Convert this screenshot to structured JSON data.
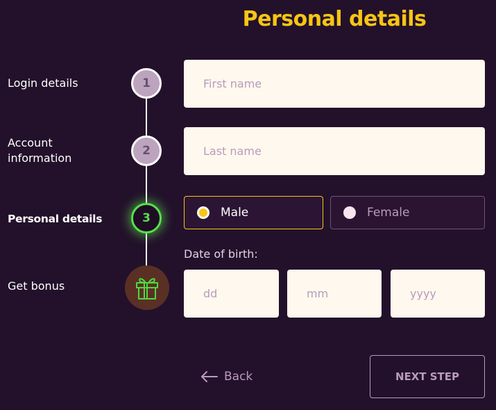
{
  "header": {
    "title": "Personal details"
  },
  "steps": [
    {
      "label": "Login details",
      "number": "1"
    },
    {
      "label": "Account information",
      "label_line1": "Account",
      "label_line2": "information",
      "number": "2"
    },
    {
      "label": "Personal details",
      "number": "3"
    },
    {
      "label": "Get bonus",
      "icon": "gift-icon"
    }
  ],
  "form": {
    "first_name": {
      "placeholder": "First name",
      "value": ""
    },
    "last_name": {
      "placeholder": "Last name",
      "value": ""
    },
    "gender": {
      "options": [
        "Male",
        "Female"
      ],
      "selected": "Male"
    },
    "dob": {
      "label": "Date of birth:",
      "day_placeholder": "dd",
      "month_placeholder": "mm",
      "year_placeholder": "yyyy"
    }
  },
  "nav": {
    "back_label": "Back",
    "next_label": "NEXT STEP"
  },
  "colors": {
    "background": "#23112b",
    "accent": "#f7c514",
    "active_step": "#57e04a",
    "field_bg": "#fff8ee"
  }
}
